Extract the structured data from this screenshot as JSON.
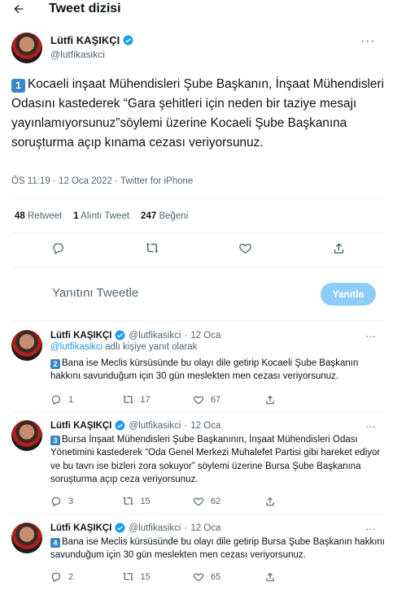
{
  "header": {
    "title": "Tweet dizisi",
    "back_icon": "arrow-left-icon"
  },
  "main_tweet": {
    "author_name": "Lütfi KAŞIKÇI",
    "author_handle": "@lutfikasikci",
    "badge": "1",
    "text": "Kocaeli inşaat Mühendisleri Şube Başkanın, İnşaat Mühendisleri Odasını kastederek “Gara şehitleri için neden bir taziye mesajı yayınlamıyorsunuz”söylemi üzerine Kocaeli Şube Başkanına soruşturma açıp kınama cezası veriyorsunuz.",
    "meta": "ÖS 11:19 · 12 Oca 2022 · Twitter for iPhone",
    "stats": {
      "retweets": "48",
      "retweets_label": "Retweet",
      "quotes": "1",
      "quotes_label": "Alıntı Tweet",
      "likes": "247",
      "likes_label": "Beğeni"
    }
  },
  "reply_box": {
    "placeholder": "Yanıtını Tweetle",
    "button": "Yanıtla"
  },
  "replies": [
    {
      "name": "Lütfi KAŞIKÇI",
      "handle": "@lutfikasikci",
      "dot": "·",
      "date": "12 Oca",
      "replying_handle": "@lutfikasikci",
      "replying_suffix": " adlı kişiye yanıt olarak",
      "badge": "2",
      "text": "Bana ise Meclis kürsüsünde bu olayı dile getirip Kocaeli Şube Başkanın hakkını savunduğum için 30 gün meslekten men cezası veriyorsunuz.",
      "replies": "1",
      "retweets": "17",
      "likes": "67"
    },
    {
      "name": "Lütfi KAŞIKÇI",
      "handle": "@lutfikasikci",
      "dot": "·",
      "date": "12 Oca",
      "badge": "3",
      "text": "Bursa İnşaat Mühendisleri Şube Başkanının, İnşaat Mühendisleri Odası Yönetimini kastederek “Oda Genel Merkezi Muhalefet Partisi gibi hareket ediyor ve bu tavrı ise bizleri zora sokuyor” söylemi üzerine Bursa Şube Başkanına soruşturma açıp ceza veriyorsunuz.",
      "replies": "3",
      "retweets": "15",
      "likes": "62"
    },
    {
      "name": "Lütfi KAŞIKÇI",
      "handle": "@lutfikasikci",
      "dot": "·",
      "date": "12 Oca",
      "badge": "4",
      "text": "Bana ise Meclis kürsüsünde bu olayı dile getirip Bursa Şube Başkanın hakkını savunduğum için 30 gün meslekten men cezası veriyorsunuz.",
      "replies": "2",
      "retweets": "15",
      "likes": "65"
    }
  ],
  "colors": {
    "accent": "#1d9bf0",
    "reply_button": "#8ecdf8",
    "badge": "#3b87c6",
    "muted": "#536471"
  }
}
